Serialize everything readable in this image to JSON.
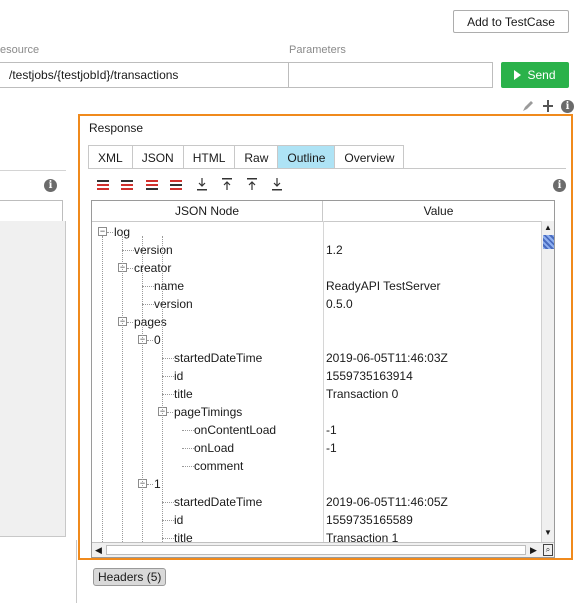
{
  "header": {
    "add_testcase_label": "Add to TestCase",
    "resource_label": "esource",
    "parameters_label": "Parameters",
    "resource_value": "/testjobs/{testjobId}/transactions",
    "parameters_value": "",
    "send_label": "Send"
  },
  "response": {
    "title": "Response",
    "tabs": [
      "XML",
      "JSON",
      "HTML",
      "Raw",
      "Outline",
      "Overview"
    ],
    "active_tab": "Outline",
    "columns": [
      "JSON Node",
      "Value"
    ],
    "rows": [
      {
        "name": "log",
        "value": ""
      },
      {
        "name": "version",
        "value": "1.2"
      },
      {
        "name": "creator",
        "value": ""
      },
      {
        "name": "name",
        "value": "ReadyAPI TestServer"
      },
      {
        "name": "version",
        "value": "0.5.0"
      },
      {
        "name": "pages",
        "value": ""
      },
      {
        "name": "0",
        "value": ""
      },
      {
        "name": "startedDateTime",
        "value": "2019-06-05T11:46:03Z"
      },
      {
        "name": "id",
        "value": "1559735163914"
      },
      {
        "name": "title",
        "value": "Transaction 0"
      },
      {
        "name": "pageTimings",
        "value": ""
      },
      {
        "name": "onContentLoad",
        "value": "-1"
      },
      {
        "name": "onLoad",
        "value": "-1"
      },
      {
        "name": "comment",
        "value": ""
      },
      {
        "name": "1",
        "value": ""
      },
      {
        "name": "startedDateTime",
        "value": "2019-06-05T11:46:05Z"
      },
      {
        "name": "id",
        "value": "1559735165589"
      },
      {
        "name": "title",
        "value": "Transaction 1"
      }
    ]
  },
  "footer": {
    "headers_label": "Headers (5)"
  },
  "colors": {
    "accent_border": "#f08a1c",
    "send_green": "#2ab24a",
    "active_tab": "#aee3f5",
    "toolbar_red": "#d0312d"
  }
}
